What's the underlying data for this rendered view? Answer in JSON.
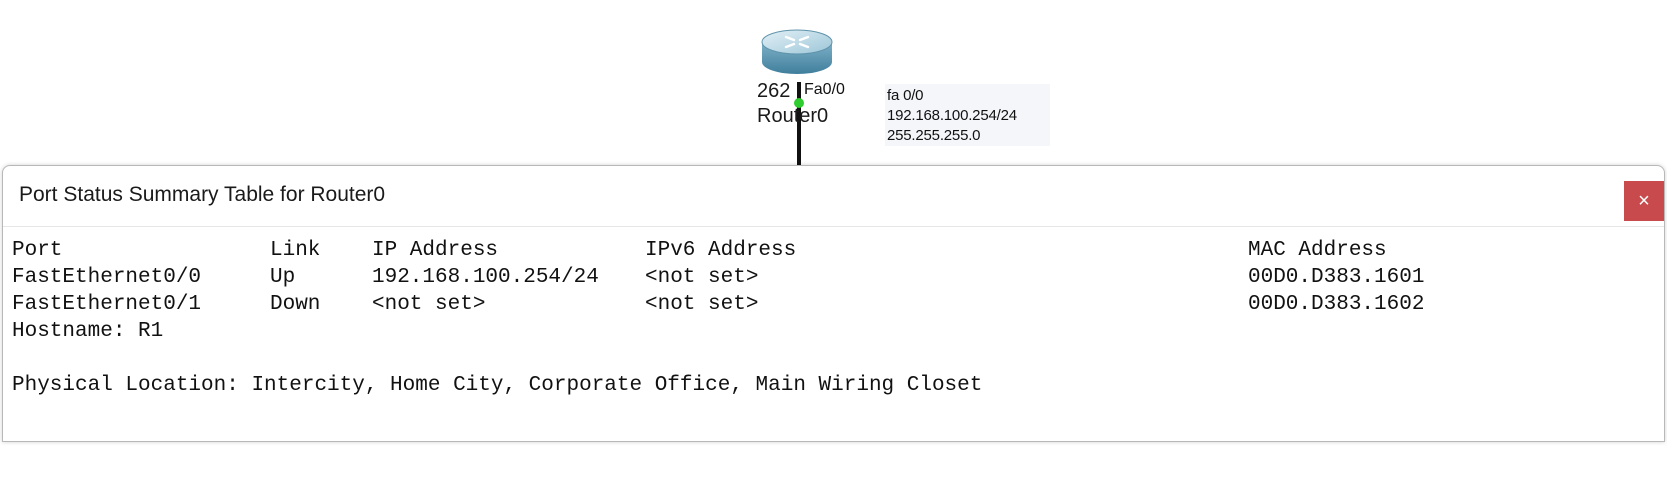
{
  "topology": {
    "device": {
      "model": "262",
      "name": "Router0",
      "icon": "router-icon",
      "port_label": "Fa0/0",
      "link_status_color": "#2ecc2e"
    },
    "note": {
      "lines": [
        "fa 0/0",
        "192.168.100.254/24",
        "255.255.255.0"
      ]
    }
  },
  "popup": {
    "title": "Port Status Summary Table for Router0",
    "close_label": "×",
    "close_color": "#c84a4d",
    "table": {
      "headers": [
        "Port",
        "Link",
        "IP Address",
        "IPv6 Address",
        "MAC Address"
      ],
      "rows": [
        [
          "FastEthernet0/0",
          "Up",
          "192.168.100.254/24",
          "<not set>",
          "00D0.D383.1601"
        ],
        [
          "FastEthernet0/1",
          "Down",
          "<not set>",
          "<not set>",
          "00D0.D383.1602"
        ]
      ]
    },
    "hostname_line": "Hostname: R1",
    "location_line": "Physical Location: Intercity, Home City, Corporate Office, Main Wiring Closet"
  }
}
